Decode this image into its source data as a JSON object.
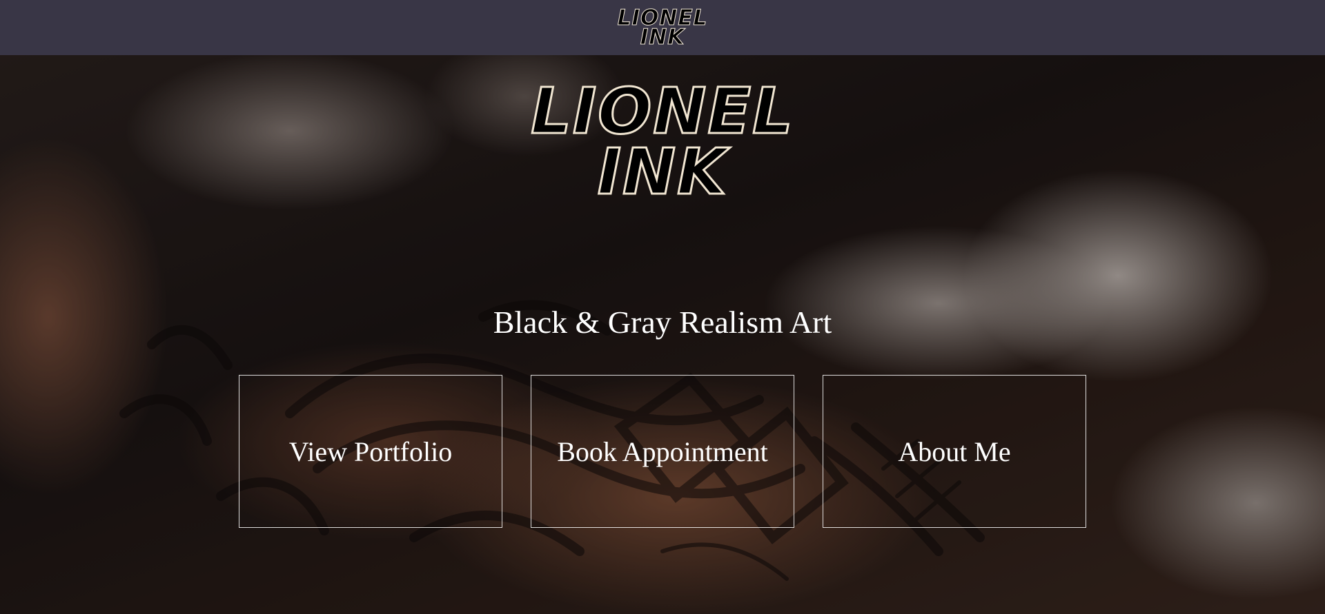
{
  "header": {
    "logo_line1": "LIONEL",
    "logo_line2": "INK",
    "background_color": "#393646"
  },
  "hero": {
    "logo_line1": "LIONEL",
    "logo_line2": "INK",
    "tagline": "Black & Gray Realism Art",
    "buttons": [
      {
        "label": "View Portfolio"
      },
      {
        "label": "Book Appointment"
      },
      {
        "label": "About Me"
      }
    ],
    "logo_fill_color": "#000000",
    "logo_outline_color": "#f1e6d2"
  }
}
